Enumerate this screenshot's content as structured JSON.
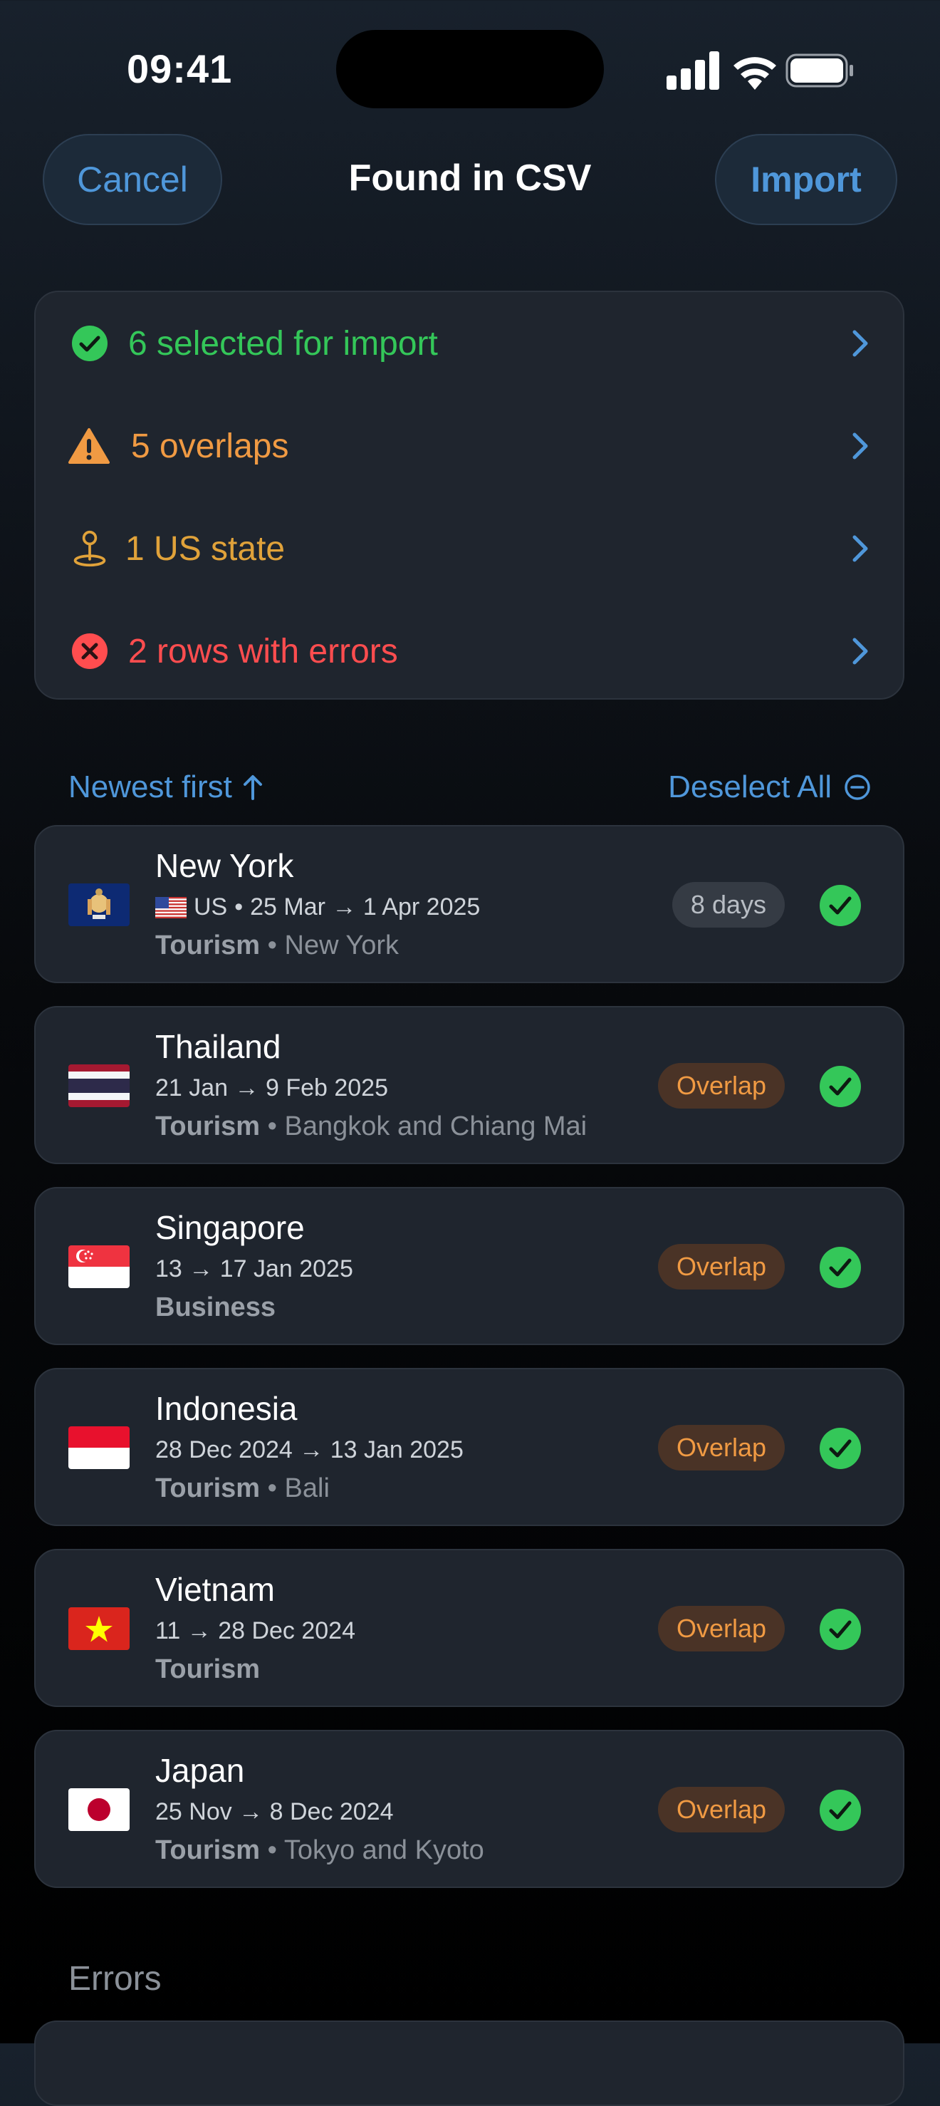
{
  "status_bar": {
    "time": "09:41"
  },
  "nav": {
    "cancel_label": "Cancel",
    "title": "Found in CSV",
    "import_label": "Import"
  },
  "summary": [
    {
      "label": "6 selected for import",
      "color": "#34c759",
      "icon": "checkmark-circle-icon"
    },
    {
      "label": "5 overlaps",
      "color": "#f09a43",
      "icon": "warning-triangle-icon"
    },
    {
      "label": "1 US state",
      "color": "#e0a23a",
      "icon": "location-pin-icon"
    },
    {
      "label": "2 rows with errors",
      "color": "#ff4d4f",
      "icon": "error-circle-icon"
    }
  ],
  "sort": {
    "order_label": "Newest first",
    "deselect_label": "Deselect All"
  },
  "trips": [
    {
      "name": "New York",
      "country_code": "US",
      "dates": "25 Mar → 1 Apr 2025",
      "purpose": "Tourism",
      "place": "New York",
      "badge": "8 days",
      "badge_type": "days",
      "flag": "new-york-flag-icon"
    },
    {
      "name": "Thailand",
      "dates": "21 Jan → 9 Feb 2025",
      "purpose": "Tourism",
      "place": "Bangkok and Chiang Mai",
      "badge": "Overlap",
      "badge_type": "overlap",
      "flag": "thailand-flag-icon"
    },
    {
      "name": "Singapore",
      "dates": "13 → 17 Jan 2025",
      "purpose": "Business",
      "place": "",
      "badge": "Overlap",
      "badge_type": "overlap",
      "flag": "singapore-flag-icon"
    },
    {
      "name": "Indonesia",
      "dates": "28 Dec 2024 → 13 Jan 2025",
      "purpose": "Tourism",
      "place": "Bali",
      "badge": "Overlap",
      "badge_type": "overlap",
      "flag": "indonesia-flag-icon"
    },
    {
      "name": "Vietnam",
      "dates": "11 → 28 Dec 2024",
      "purpose": "Tourism",
      "place": "",
      "badge": "Overlap",
      "badge_type": "overlap",
      "flag": "vietnam-flag-icon"
    },
    {
      "name": "Japan",
      "dates": "25 Nov → 8 Dec 2024",
      "purpose": "Tourism",
      "place": "Tokyo and Kyoto",
      "badge": "Overlap",
      "badge_type": "overlap",
      "flag": "japan-flag-icon"
    }
  ],
  "errors": {
    "header": "Errors"
  },
  "colors": {
    "accent": "#4f97da",
    "success": "#34c759",
    "overlap": "#f09a43",
    "error": "#ff4d4f"
  }
}
